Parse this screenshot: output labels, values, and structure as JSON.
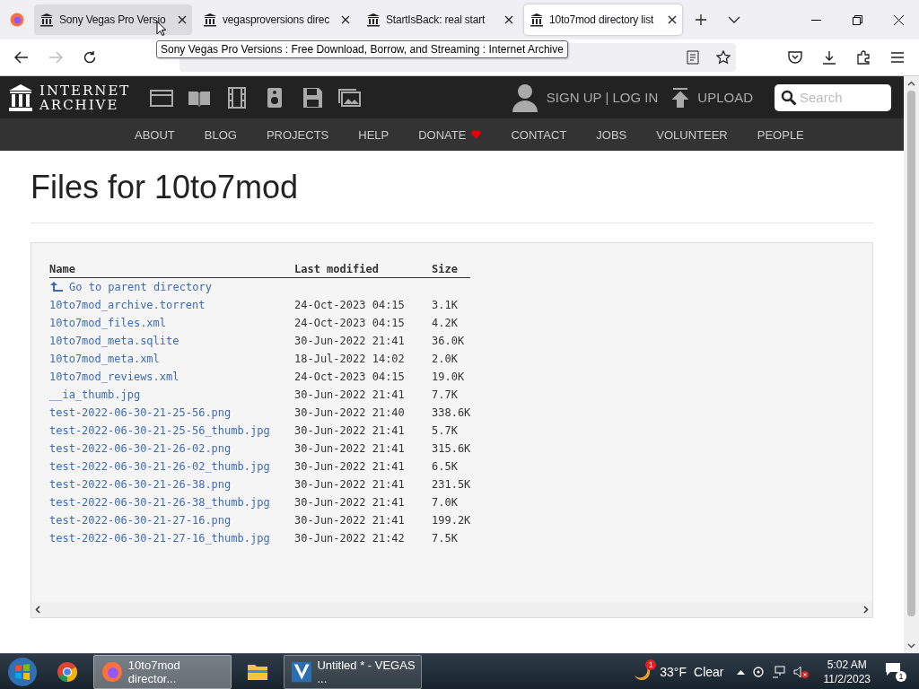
{
  "tabs": [
    {
      "title": "Sony Vegas Pro Versio",
      "selected": false,
      "hovered": true
    },
    {
      "title": "vegasproversions direc",
      "selected": false,
      "hovered": false
    },
    {
      "title": "StartIsBack: real start",
      "selected": false,
      "hovered": false
    },
    {
      "title": "10to7mod directory list",
      "selected": true,
      "hovered": false
    }
  ],
  "tooltip": "Sony Vegas Pro Versions : Free Download, Borrow, and Streaming : Internet Archive",
  "header": {
    "logo_lines": [
      "INTERNET",
      "ARCHIVE"
    ],
    "account": "SIGN UP | LOG IN",
    "upload": "UPLOAD",
    "search": {
      "placeholder": "Search"
    }
  },
  "nav": [
    {
      "label": "ABOUT",
      "kind": "link"
    },
    {
      "label": "BLOG",
      "kind": "link"
    },
    {
      "label": "PROJECTS",
      "kind": "link"
    },
    {
      "label": "HELP",
      "kind": "link"
    },
    {
      "label": "DONATE",
      "kind": "donate"
    },
    {
      "label": "CONTACT",
      "kind": "link"
    },
    {
      "label": "JOBS",
      "kind": "link"
    },
    {
      "label": "VOLUNTEER",
      "kind": "link"
    },
    {
      "label": "PEOPLE",
      "kind": "link"
    }
  ],
  "page_title": "Files for 10to7mod",
  "table": {
    "columns": [
      "Name",
      "Last modified",
      "Size"
    ],
    "parent_link": "Go to parent directory",
    "rows": [
      {
        "name": "10to7mod_archive.torrent",
        "modified": "24-Oct-2023 04:15",
        "size": "3.1K"
      },
      {
        "name": "10to7mod_files.xml",
        "modified": "24-Oct-2023 04:15",
        "size": "4.2K"
      },
      {
        "name": "10to7mod_meta.sqlite",
        "modified": "30-Jun-2022 21:41",
        "size": "36.0K"
      },
      {
        "name": "10to7mod_meta.xml",
        "modified": "18-Jul-2022 14:02",
        "size": "2.0K"
      },
      {
        "name": "10to7mod_reviews.xml",
        "modified": "24-Oct-2023 04:15",
        "size": "19.0K"
      },
      {
        "name": "__ia_thumb.jpg",
        "modified": "30-Jun-2022 21:41",
        "size": "7.7K"
      },
      {
        "name": "test-2022-06-30-21-25-56.png",
        "modified": "30-Jun-2022 21:40",
        "size": "338.6K"
      },
      {
        "name": "test-2022-06-30-21-25-56_thumb.jpg",
        "modified": "30-Jun-2022 21:41",
        "size": "5.7K"
      },
      {
        "name": "test-2022-06-30-21-26-02.png",
        "modified": "30-Jun-2022 21:41",
        "size": "315.6K"
      },
      {
        "name": "test-2022-06-30-21-26-02_thumb.jpg",
        "modified": "30-Jun-2022 21:41",
        "size": "6.5K"
      },
      {
        "name": "test-2022-06-30-21-26-38.png",
        "modified": "30-Jun-2022 21:41",
        "size": "231.5K"
      },
      {
        "name": "test-2022-06-30-21-26-38_thumb.jpg",
        "modified": "30-Jun-2022 21:41",
        "size": "7.0K"
      },
      {
        "name": "test-2022-06-30-21-27-16.png",
        "modified": "30-Jun-2022 21:41",
        "size": "199.2K"
      },
      {
        "name": "test-2022-06-30-21-27-16_thumb.jpg",
        "modified": "30-Jun-2022 21:42",
        "size": "7.5K"
      }
    ]
  },
  "taskbar": {
    "apps": [
      {
        "kind": "chrome",
        "selected": false
      },
      {
        "kind": "firefox",
        "label": "10to7mod director...",
        "selected": true
      },
      {
        "kind": "folder",
        "selected": false
      },
      {
        "kind": "vegas",
        "label": "Untitled * - VEGAS ...",
        "selected": false
      }
    ],
    "weather_badge": "1",
    "temperature": "33°F",
    "weather": "Clear",
    "time": "5:02 AM",
    "date": "11/2/2023",
    "notification_count": "1"
  }
}
